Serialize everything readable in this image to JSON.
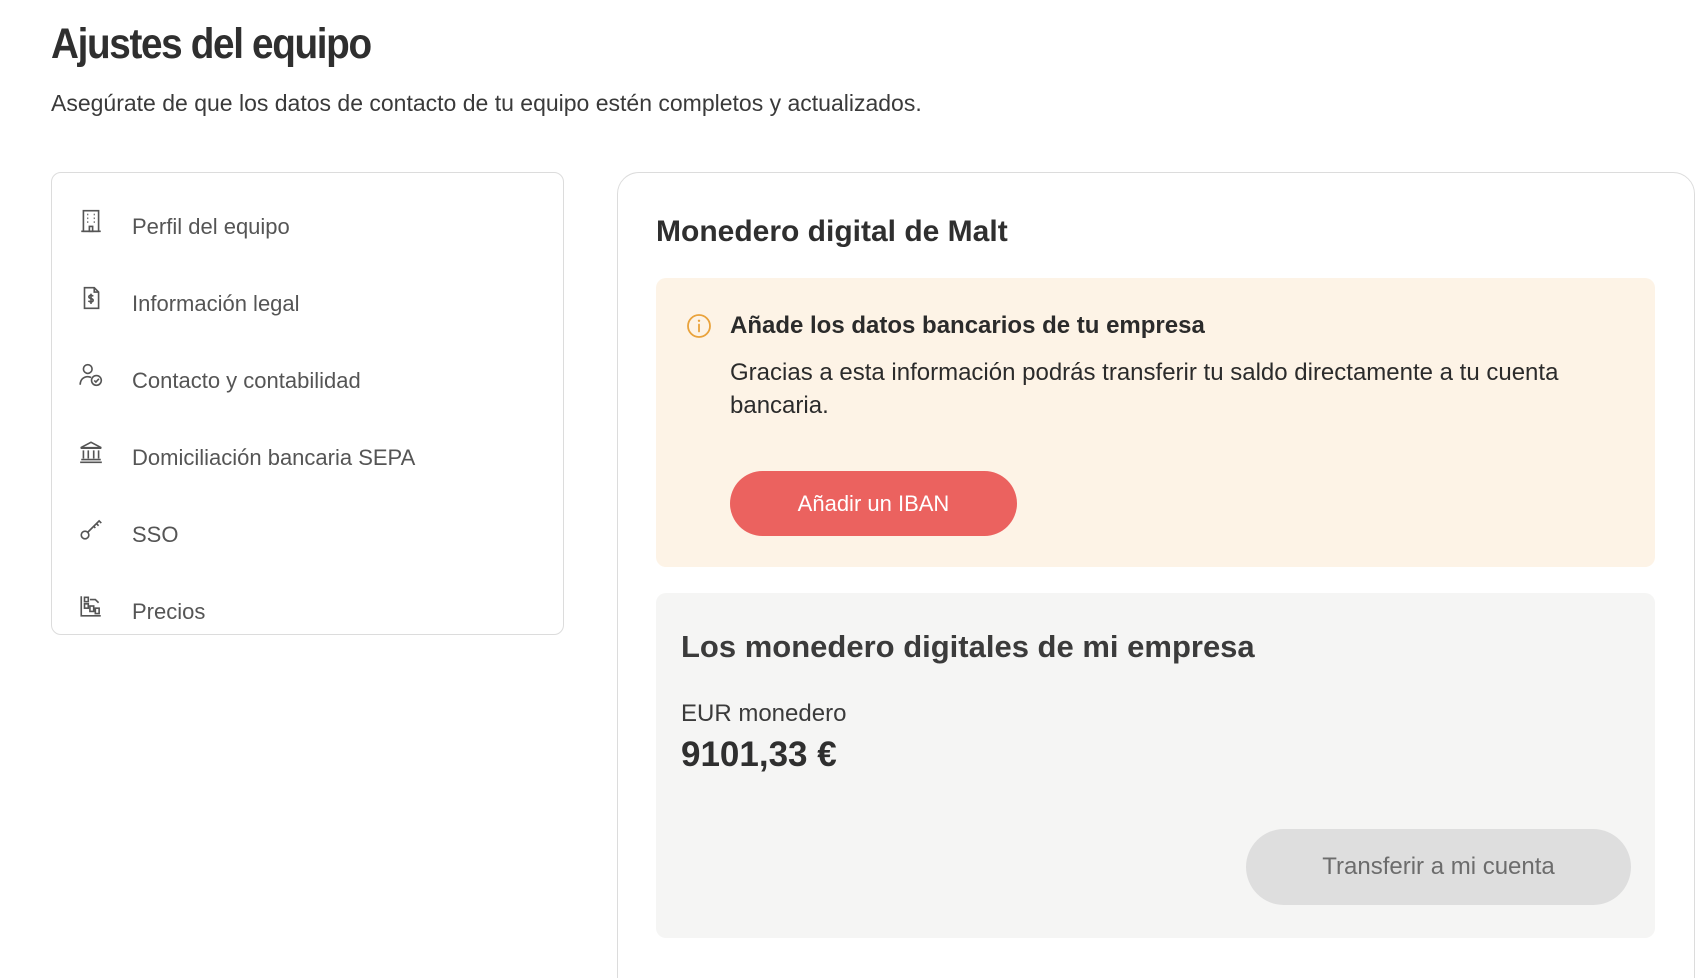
{
  "header": {
    "title": "Ajustes del equipo",
    "subtitle": "Asegúrate de que los datos de contacto de tu equipo estén completos y actualizados."
  },
  "sidebar": {
    "items": [
      {
        "label": "Perfil del equipo",
        "icon": "building-icon"
      },
      {
        "label": "Información legal",
        "icon": "document-dollar-icon"
      },
      {
        "label": "Contacto y contabilidad",
        "icon": "user-check-icon"
      },
      {
        "label": "Domiciliación bancaria SEPA",
        "icon": "bank-icon"
      },
      {
        "label": "SSO",
        "icon": "key-icon"
      },
      {
        "label": "Precios",
        "icon": "pricing-icon"
      }
    ]
  },
  "main": {
    "title": "Monedero digital de Malt",
    "alert": {
      "title": "Añade los datos bancarios de tu empresa",
      "body": "Gracias a esta información podrás transferir tu saldo directamente a tu cuenta bancaria.",
      "button_label": "Añadir un IBAN",
      "icon": "info-icon"
    },
    "wallets": {
      "title": "Los monedero digitales de mi empresa",
      "wallet_label": "EUR monedero",
      "amount": "9101,33 €",
      "transfer_label": "Transferir a mi cuenta"
    }
  },
  "colors": {
    "accent": "#eb625f",
    "alert_bg": "#fdf3e6",
    "info_icon": "#e9a23b",
    "wallet_bg": "#f5f5f4",
    "disabled_button": "#dedede"
  }
}
